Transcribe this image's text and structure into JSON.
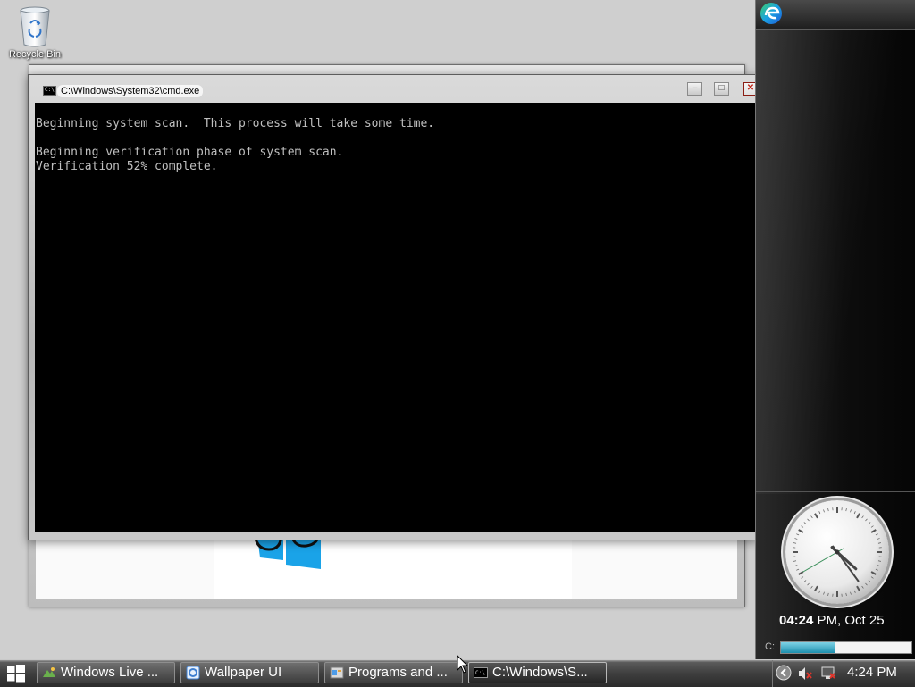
{
  "desktop": {
    "recycle_bin_label": "Recycle Bin"
  },
  "cmd_window": {
    "title": "C:\\Windows\\System32\\cmd.exe",
    "minimize_glyph": "–",
    "maximize_glyph": "□",
    "close_glyph": "✕",
    "console_lines": [
      "Beginning system scan.  This process will take some time.",
      "",
      "Beginning verification phase of system scan.",
      "Verification 52% complete."
    ]
  },
  "sidebar": {
    "clock_time_bold": "04:24",
    "clock_rest": " PM, Oct 25",
    "drive_label": "C:",
    "drive_usage_fraction": 0.42,
    "clock_hands": {
      "hour": 4,
      "minute": 24,
      "second": 40
    }
  },
  "taskbar": {
    "buttons": [
      {
        "label": "Windows Live ...",
        "icon": "windows-live-icon"
      },
      {
        "label": "Wallpaper UI",
        "icon": "wallpaper-ui-icon"
      },
      {
        "label": "Programs and ...",
        "icon": "programs-icon"
      },
      {
        "label": "C:\\Windows\\S...",
        "icon": "cmd-icon"
      }
    ],
    "tray_time": "4:24 PM"
  },
  "colors": {
    "console_bg": "#000000",
    "console_text": "#c0c0c0",
    "windows_blue": "#1aa3e8",
    "edge_blue": "#1e88e5",
    "edge_green": "#3ccf6b",
    "close_red": "#c0281a"
  }
}
